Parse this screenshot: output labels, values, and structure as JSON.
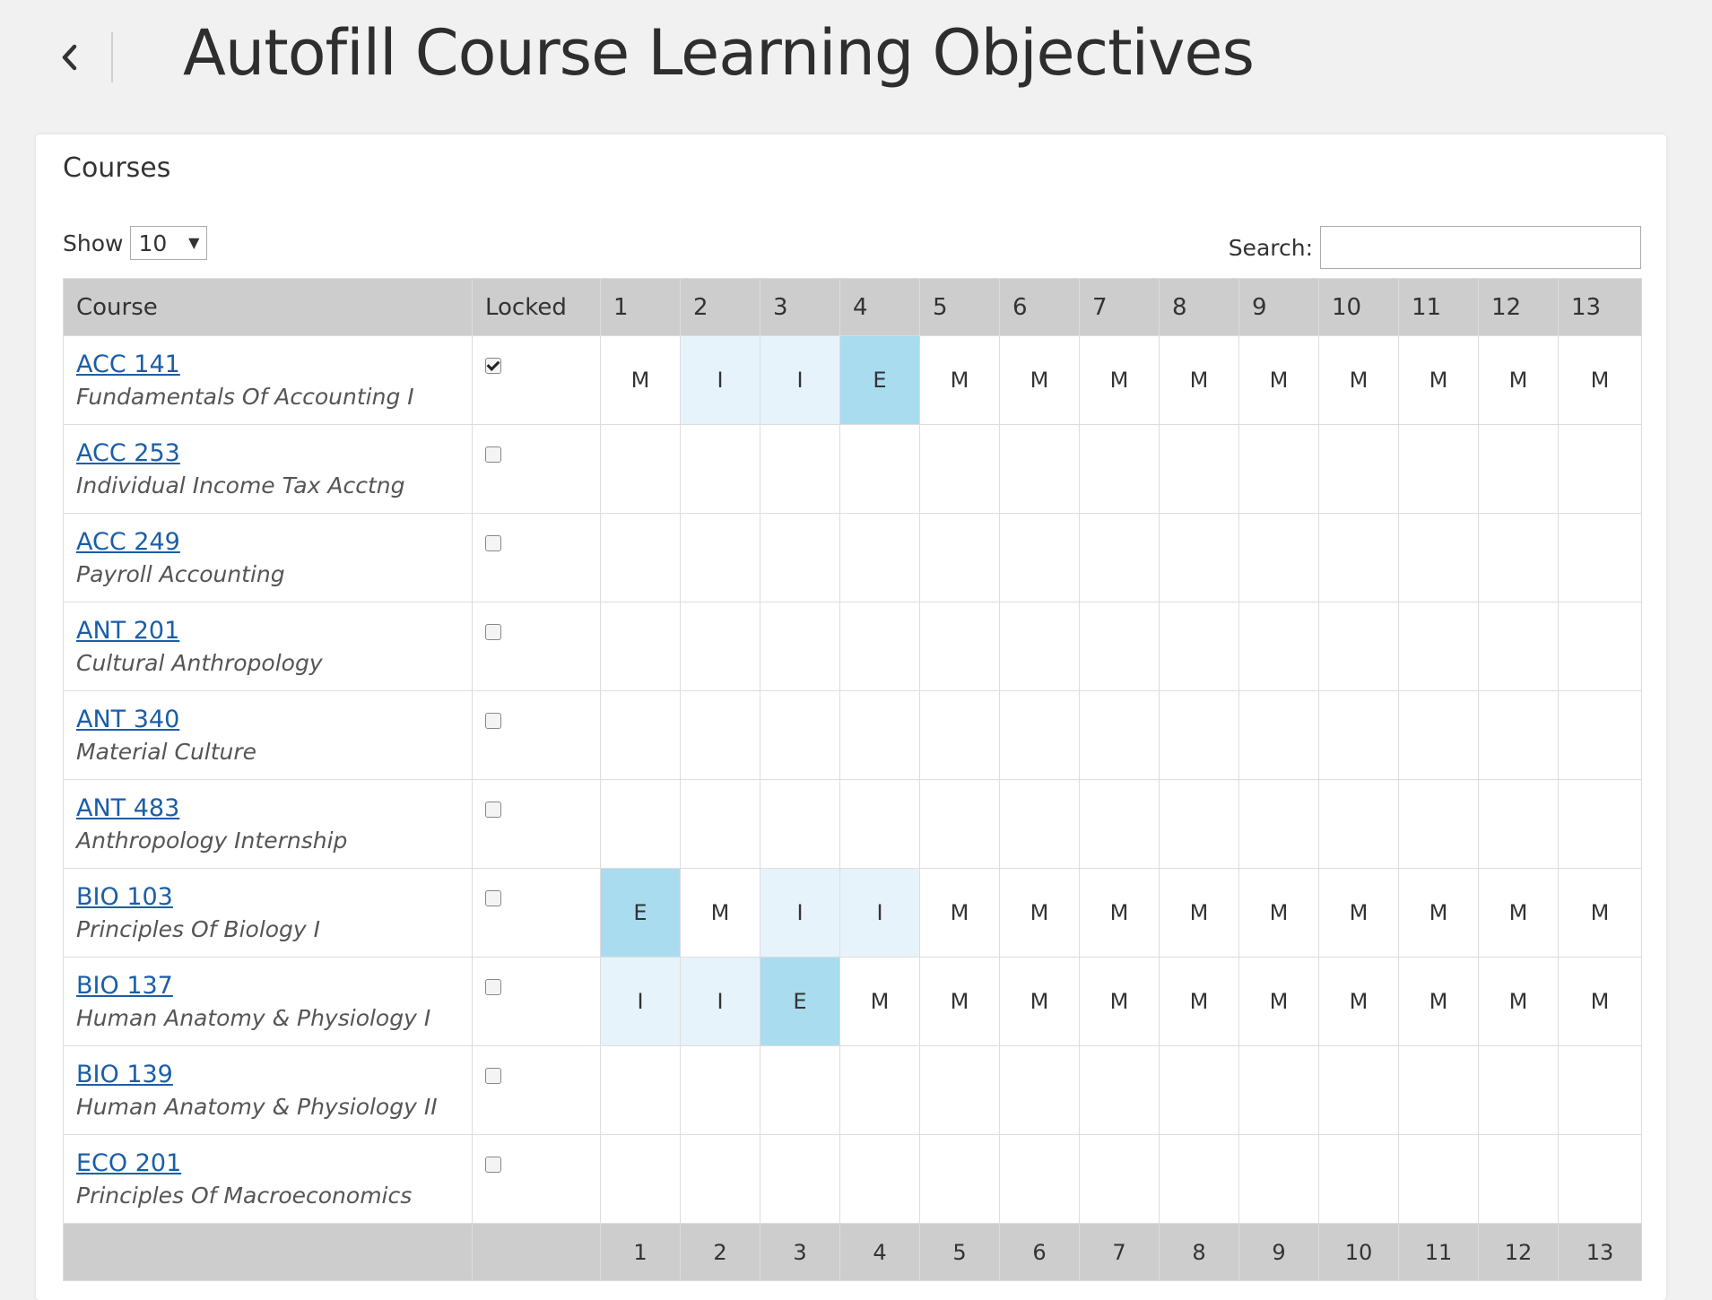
{
  "page": {
    "title": "Autofill Course Learning Objectives"
  },
  "panel": {
    "title": "Courses",
    "show_label": "Show",
    "show_value": "10",
    "search_label": "Search:",
    "search_value": ""
  },
  "table": {
    "headers": [
      "Course",
      "Locked",
      "1",
      "2",
      "3",
      "4",
      "5",
      "6",
      "7",
      "8",
      "9",
      "10",
      "11",
      "12",
      "13"
    ],
    "footer": [
      "",
      "",
      "1",
      "2",
      "3",
      "4",
      "5",
      "6",
      "7",
      "8",
      "9",
      "10",
      "11",
      "12",
      "13"
    ],
    "rows": [
      {
        "code": "ACC 141",
        "name": "Fundamentals Of Accounting I",
        "locked": true,
        "values": [
          "M",
          "I",
          "I",
          "E",
          "M",
          "M",
          "M",
          "M",
          "M",
          "M",
          "M",
          "M",
          "M"
        ]
      },
      {
        "code": "ACC 253",
        "name": "Individual Income Tax Acctng",
        "locked": false,
        "values": [
          "",
          "",
          "",
          "",
          "",
          "",
          "",
          "",
          "",
          "",
          "",
          "",
          ""
        ]
      },
      {
        "code": "ACC 249",
        "name": "Payroll Accounting",
        "locked": false,
        "values": [
          "",
          "",
          "",
          "",
          "",
          "",
          "",
          "",
          "",
          "",
          "",
          "",
          ""
        ]
      },
      {
        "code": "ANT 201",
        "name": "Cultural Anthropology",
        "locked": false,
        "values": [
          "",
          "",
          "",
          "",
          "",
          "",
          "",
          "",
          "",
          "",
          "",
          "",
          ""
        ]
      },
      {
        "code": "ANT 340",
        "name": "Material Culture",
        "locked": false,
        "values": [
          "",
          "",
          "",
          "",
          "",
          "",
          "",
          "",
          "",
          "",
          "",
          "",
          ""
        ]
      },
      {
        "code": "ANT 483",
        "name": "Anthropology Internship",
        "locked": false,
        "values": [
          "",
          "",
          "",
          "",
          "",
          "",
          "",
          "",
          "",
          "",
          "",
          "",
          ""
        ]
      },
      {
        "code": "BIO 103",
        "name": "Principles Of Biology I",
        "locked": false,
        "values": [
          "E",
          "M",
          "I",
          "I",
          "M",
          "M",
          "M",
          "M",
          "M",
          "M",
          "M",
          "M",
          "M"
        ]
      },
      {
        "code": "BIO 137",
        "name": "Human Anatomy & Physiology I",
        "locked": false,
        "values": [
          "I",
          "I",
          "E",
          "M",
          "M",
          "M",
          "M",
          "M",
          "M",
          "M",
          "M",
          "M",
          "M"
        ]
      },
      {
        "code": "BIO 139",
        "name": "Human Anatomy & Physiology II",
        "locked": false,
        "values": [
          "",
          "",
          "",
          "",
          "",
          "",
          "",
          "",
          "",
          "",
          "",
          "",
          ""
        ]
      },
      {
        "code": "ECO 201",
        "name": "Principles Of Macroeconomics",
        "locked": false,
        "values": [
          "",
          "",
          "",
          "",
          "",
          "",
          "",
          "",
          "",
          "",
          "",
          "",
          ""
        ]
      }
    ]
  },
  "colors": {
    "introduced": "#e6f3fa",
    "emphasized": "#a9dcef",
    "header_bg": "#cdcdcd",
    "link": "#1a5ea8"
  },
  "icons": {
    "back": "chevron-left-icon",
    "select": "caret-down-icon"
  }
}
